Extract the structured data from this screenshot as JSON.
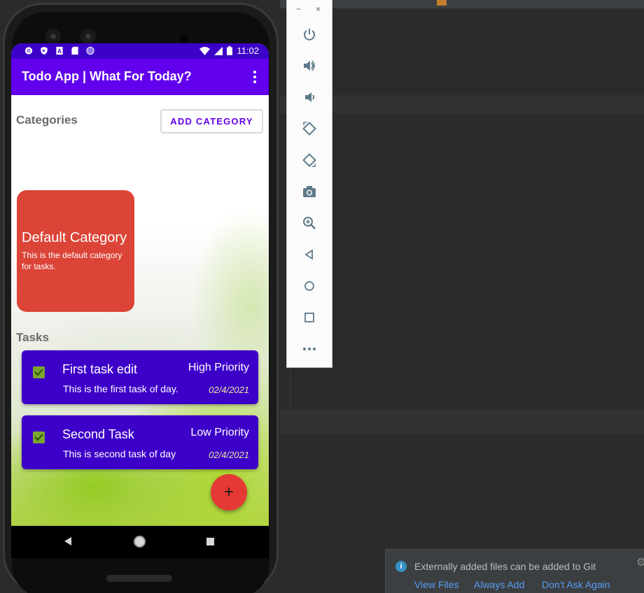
{
  "ide": {
    "tab1_text": "",
    "tab2_text": ""
  },
  "statusbar": {
    "time": "11:02",
    "left_icons": [
      "gear-icon",
      "shield-icon",
      "a-icon",
      "sd-card-icon",
      "circle-icon"
    ],
    "right_icons": [
      "wifi-icon",
      "signal-icon",
      "battery-icon"
    ]
  },
  "appbar": {
    "title": "Todo App | What For Today?",
    "menu_icon": "more-vert-icon"
  },
  "categories": {
    "heading": "Categories",
    "add_button": "ADD CATEGORY",
    "items": [
      {
        "name": "Default Category",
        "description": "This is the default category for tasks.",
        "color": "#db4437"
      }
    ]
  },
  "tasks": {
    "heading": "Tasks",
    "items": [
      {
        "title": "First task edit",
        "priority": "High Priority",
        "description": "This is the first task of day.",
        "date": "02/4/2021",
        "checked": true
      },
      {
        "title": "Second Task",
        "priority": "Low Priority",
        "description": "This is second task of day",
        "date": "02/4/2021",
        "checked": true
      }
    ]
  },
  "fab": {
    "label": "+"
  },
  "navbar": {
    "buttons": [
      "back-icon",
      "home-icon",
      "recents-icon"
    ]
  },
  "emulator": {
    "minimize": "−",
    "close": "×",
    "buttons": [
      "power-icon",
      "volume-up-icon",
      "volume-down-icon",
      "rotate-left-icon",
      "rotate-right-icon",
      "camera-icon",
      "zoom-icon",
      "back-icon",
      "home-icon",
      "overview-icon",
      "more-icon"
    ]
  },
  "notification": {
    "message": "Externally added files can be added to Git",
    "actions": [
      "View Files",
      "Always Add",
      "Don't Ask Again"
    ]
  },
  "colors": {
    "primary": "#6200ee",
    "primary_dark": "#3d00c8",
    "category_red": "#db4437",
    "fab_red": "#e53935",
    "check_green": "#7aa62e"
  }
}
